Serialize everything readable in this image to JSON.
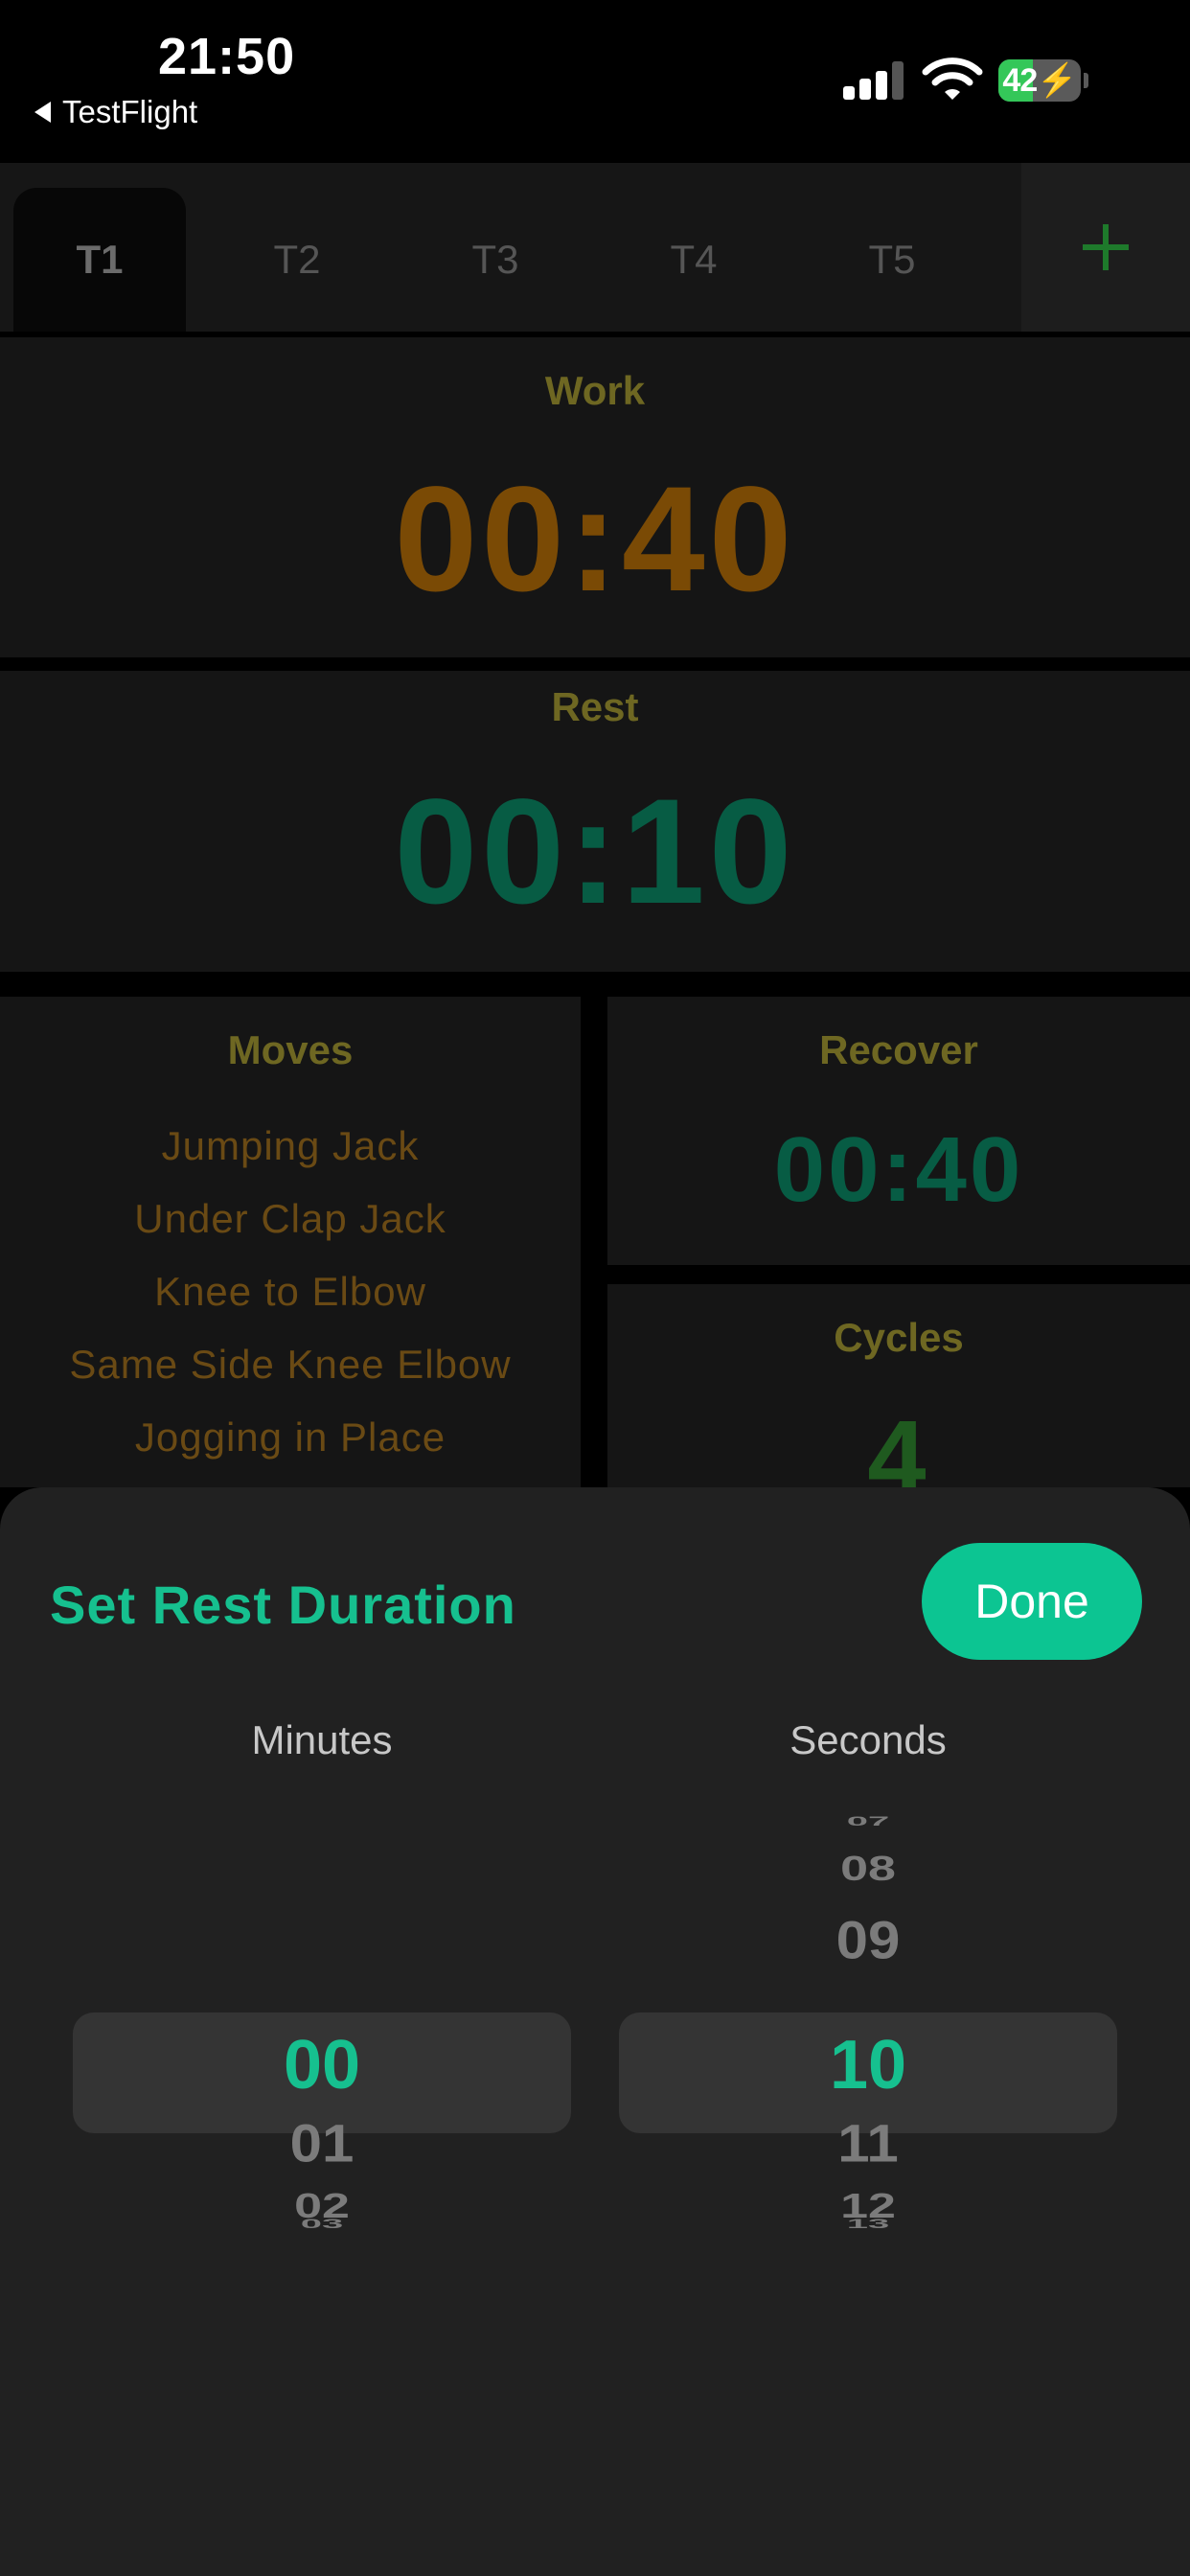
{
  "status_bar": {
    "time": "21:50",
    "back_label": "TestFlight",
    "battery_level": "42"
  },
  "tabs": [
    {
      "label": "T1",
      "active": true
    },
    {
      "label": "T2",
      "active": false
    },
    {
      "label": "T3",
      "active": false
    },
    {
      "label": "T4",
      "active": false
    },
    {
      "label": "T5",
      "active": false
    }
  ],
  "add_tab_icon": "plus-icon",
  "work": {
    "label": "Work",
    "time": "00:40",
    "color": "#7a4a05"
  },
  "rest": {
    "label": "Rest",
    "time": "00:10",
    "color": "#075c44"
  },
  "moves": {
    "label": "Moves",
    "items": [
      "Jumping Jack",
      "Under Clap Jack",
      "Knee to Elbow",
      "Same Side Knee Elbow",
      "Jogging in Place"
    ]
  },
  "recover": {
    "label": "Recover",
    "time": "00:40",
    "color": "#075c44"
  },
  "cycles": {
    "label": "Cycles",
    "value": "4",
    "color": "#1f5a1f"
  },
  "sheet": {
    "title": "Set Rest Duration",
    "done_label": "Done",
    "accent": "#16c08f",
    "minutes": {
      "header": "Minutes",
      "selected": "00",
      "below": [
        "01",
        "02",
        "03"
      ]
    },
    "seconds": {
      "header": "Seconds",
      "above": [
        "07",
        "08",
        "09"
      ],
      "selected": "10",
      "below": [
        "11",
        "12",
        "13"
      ]
    }
  }
}
